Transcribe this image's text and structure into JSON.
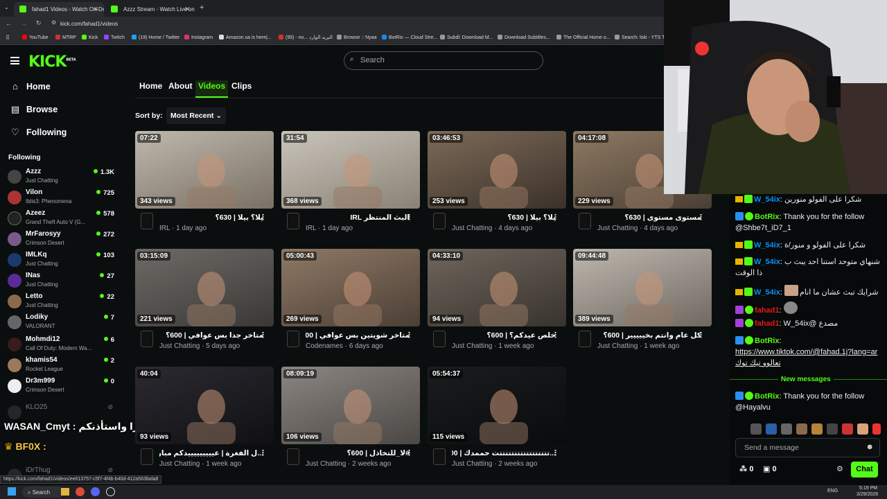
{
  "browser": {
    "tabs": [
      {
        "title": "fahad1 Videos - Watch On-Dem"
      },
      {
        "title": "Azzz Stream - Watch Live on Ki"
      }
    ],
    "url": "kick.com/fahad1/videos",
    "status_url": "https://kick.com/fahad1/videos/ee613757-c5f7-4f4b-b40d-412a563fada8"
  },
  "bookmarks": [
    "YouTube",
    "MTRP",
    "Kick",
    "Twitch",
    "(19) Home / Twitter",
    "Instagram",
    "Amazon.sa is here|...",
    "(95) - no... البريد الوارد",
    "Browse :: Nyaa",
    "BotRix — Cloud Stre...",
    "Subdl: Download M...",
    "Download Subtitles...",
    "The Official Home o...",
    "Search: loki - YTS TV..."
  ],
  "header": {
    "search_placeholder": "Search",
    "logo": "KICK",
    "beta": "BETA"
  },
  "sidebar": {
    "nav": [
      {
        "label": "Home"
      },
      {
        "label": "Browse"
      },
      {
        "label": "Following"
      }
    ],
    "following_title": "Following",
    "channels": [
      {
        "name": "Azzz",
        "category": "Just Chatting",
        "viewers": "1.3K"
      },
      {
        "name": "Vilon",
        "category": "Iblis3: Phenomena",
        "viewers": "725"
      },
      {
        "name": "Azeez",
        "category": "Grand Theft Auto V (G...",
        "viewers": "578"
      },
      {
        "name": "MrFarosyy",
        "category": "Crimson Desert",
        "viewers": "272"
      },
      {
        "name": "IMLKq",
        "category": "Just Chatting",
        "viewers": "103"
      },
      {
        "name": "INas",
        "category": "Just Chatting",
        "viewers": "27"
      },
      {
        "name": "Letto",
        "category": "Just Chatting",
        "viewers": "22"
      },
      {
        "name": "Lodiky",
        "category": "VALORANT",
        "viewers": "7"
      },
      {
        "name": "Mohmdi12",
        "category": "Call Of Duty: Modern Wa...",
        "viewers": "6"
      },
      {
        "name": "khamis54",
        "category": "Rocket League",
        "viewers": "2"
      },
      {
        "name": "Dr3m999",
        "category": "Crimson Desert",
        "viewers": "0"
      }
    ],
    "offline": [
      "KLO25",
      "iDrThug"
    ]
  },
  "channel_tabs": [
    "Home",
    "About",
    "Videos",
    "Clips"
  ],
  "sort": {
    "label": "Sort by:",
    "value": "Most Recent"
  },
  "videos": [
    {
      "duration": "07:22",
      "views": "343 views",
      "title": "يلا؟ بيلا | 630؟",
      "category": "IRL",
      "age": "1 day ago"
    },
    {
      "duration": "31:54",
      "views": "368 views",
      "title": "البث المنتظر IRL",
      "category": "IRL",
      "age": "1 day ago"
    },
    {
      "duration": "03:46:53",
      "views": "253 views",
      "title": "يلا؟ بيلا | 630؟",
      "category": "Just Chatting",
      "age": "4 days ago"
    },
    {
      "duration": "04:17:08",
      "views": "229 views",
      "title": "مستوى مستوى | 630؟",
      "category": "Just Chatting",
      "age": "4 days ago"
    },
    {
      "duration": "03:15:09",
      "views": "221 views",
      "title": "متاخر جدا بس عوافي | 600؟",
      "category": "Just Chatting",
      "age": "5 days ago"
    },
    {
      "duration": "05:00:43",
      "views": "269 views",
      "title": "متاخر شويتين بس عوافي | 600؟",
      "category": "Codenames",
      "age": "6 days ago"
    },
    {
      "duration": "04:33:10",
      "views": "94 views",
      "title": "خلص عيدكم؟ | 600؟",
      "category": "Just Chatting",
      "age": "1 week ago"
    },
    {
      "duration": "09:44:48",
      "views": "389 views",
      "title": "كل عام وانتم بخييييير | 600؟",
      "category": "Just Chatting",
      "age": "1 week ago"
    },
    {
      "duration": "40:04",
      "views": "93 views",
      "title": "...ل الفغرة | عيييييييييدكم مبارك !!",
      "category": "Just Chatting",
      "age": "1 week ago"
    },
    {
      "duration": "08:09:19",
      "views": "106 views",
      "title": "#لا_للتخاذل | 600؟",
      "category": "Just Chatting",
      "age": "2 weeks ago"
    },
    {
      "duration": "05:54:37",
      "views": "115 views",
      "title": "...تتتتتتتتتتتتتتتتتت حممدك | 500؟",
      "category": "Just Chatting",
      "age": "2 weeks ago"
    }
  ],
  "chat": {
    "messages": [
      {
        "user": "W_54ix",
        "text": "شكرا على الفولو منورين"
      },
      {
        "user": "BotRix",
        "text": "Thank you for the follow @Shbe7t_iD7_1"
      },
      {
        "user": "W_54ix",
        "text": "شكرا على الفولو و منور/ة"
      },
      {
        "user": "W_54ix",
        "text": "شنهاي متوحد استنا احد يبث ب ذا الوقت"
      },
      {
        "user": "W_54ix",
        "text": "شرايك تبث عشان ما انام"
      },
      {
        "user": "fahad1",
        "text": ""
      },
      {
        "user": "fahad1",
        "text": "مصدع @W_54ix"
      },
      {
        "user": "BotRix",
        "text": "https://www.tiktok.com/@fahad.1j?lang=ar تعالوو تيك توك"
      },
      {
        "user": "BotRix",
        "text": "Thank you for the follow @Hayalvu"
      }
    ],
    "new_messages": "New messages",
    "input_placeholder": "Send a message",
    "send_label": "Chat",
    "count_a": "0",
    "count_b": "0"
  },
  "overlay": {
    "line1": "شكرا واستأذنكم : WASAN_Cmyt",
    "line2": "BF0X :"
  },
  "taskbar": {
    "search": "Search",
    "lang": "ENG",
    "time": "5:19 PM",
    "date": "3/29/2026"
  },
  "colors": {
    "accent": "#53fc18",
    "bg": "#0b0e0f"
  }
}
